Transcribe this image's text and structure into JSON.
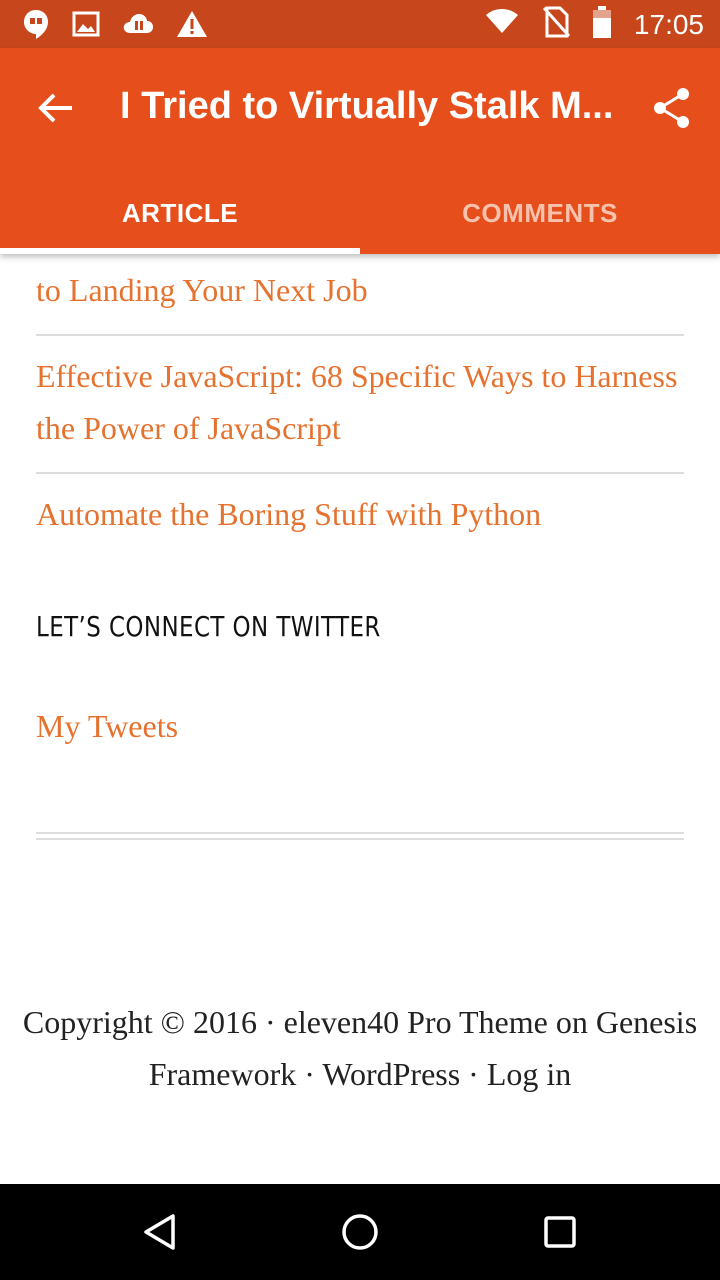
{
  "status_bar": {
    "time": "17:05",
    "left_icons": [
      "hangouts-icon",
      "image-icon",
      "cloud-icon",
      "warning-icon"
    ],
    "right_icons": [
      "wifi-icon",
      "no-sim-icon",
      "battery-icon"
    ]
  },
  "app_bar": {
    "back_icon": "back-arrow-icon",
    "title": "I Tried to Virtually Stalk M...",
    "share_icon": "share-icon",
    "color": "#e64f1c"
  },
  "tabs": [
    {
      "label": "ARTICLE",
      "selected": true
    },
    {
      "label": "COMMENTS",
      "selected": false
    }
  ],
  "content": {
    "link_color": "#e5722f",
    "book_links": [
      "to Landing Your Next Job",
      "Effective JavaScript: 68 Specific Ways to Harness the Power of JavaScript",
      "Automate the Boring Stuff with Python"
    ],
    "twitter_section": {
      "heading": "LET’S CONNECT ON TWITTER",
      "link": "My Tweets"
    },
    "footer": "Copyright © 2016 · eleven40 Pro Theme on Genesis Framework · WordPress · Log in"
  },
  "nav_bar": {
    "buttons": [
      "back-triangle-icon",
      "home-circle-icon",
      "recents-square-icon"
    ]
  }
}
